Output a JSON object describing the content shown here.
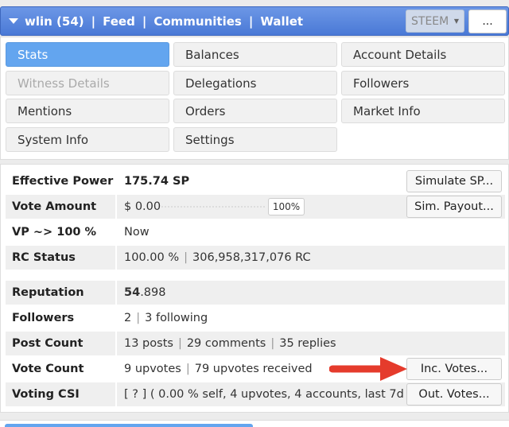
{
  "header": {
    "user": "wlin (54)",
    "separator": "|",
    "nav": [
      "Feed",
      "Communities",
      "Wallet"
    ],
    "currency_select": "STEEM",
    "more_button": "..."
  },
  "tabs": [
    {
      "label": "Stats",
      "state": "active"
    },
    {
      "label": "Balances",
      "state": "normal"
    },
    {
      "label": "Account Details",
      "state": "normal"
    },
    {
      "label": "Witness Details",
      "state": "disabled"
    },
    {
      "label": "Delegations",
      "state": "normal"
    },
    {
      "label": "Followers",
      "state": "normal"
    },
    {
      "label": "Mentions",
      "state": "normal"
    },
    {
      "label": "Orders",
      "state": "normal"
    },
    {
      "label": "Market Info",
      "state": "normal"
    },
    {
      "label": "System Info",
      "state": "normal"
    },
    {
      "label": "Settings",
      "state": "normal"
    }
  ],
  "stats": {
    "effective_power": {
      "label": "Effective Power",
      "value": "175.74 SP",
      "button": "Simulate SP..."
    },
    "vote_amount": {
      "label": "Vote Amount",
      "value": "$ 0.00",
      "percent": "100%",
      "percent_value": 100,
      "button": "Sim. Payout..."
    },
    "vp": {
      "label": "VP ~> 100 %",
      "value": "Now"
    },
    "rc_status": {
      "label": "RC Status",
      "value_a": "100.00 %",
      "value_b": "306,958,317,076 RC"
    },
    "reputation": {
      "label": "Reputation",
      "value_main": "54",
      "value_rest": ".898"
    },
    "followers": {
      "label": "Followers",
      "value_a": "2",
      "value_b": "3 following"
    },
    "post_count": {
      "label": "Post Count",
      "value_a": "13 posts",
      "value_b": "29 comments",
      "value_c": "35 replies"
    },
    "vote_count": {
      "label": "Vote Count",
      "value_a": "9 upvotes",
      "value_b": "79 upvotes received",
      "button": "Inc. Votes..."
    },
    "voting_csi": {
      "label": "Voting CSI",
      "value": "[ ? ] ( 0.00 % self, 4 upvotes, 4 accounts, last 7d )",
      "button": "Out. Votes..."
    }
  },
  "colors": {
    "header_blue": "#4a79d6",
    "active_tab": "#63a5ef",
    "arrow_red": "#e53b2c"
  }
}
